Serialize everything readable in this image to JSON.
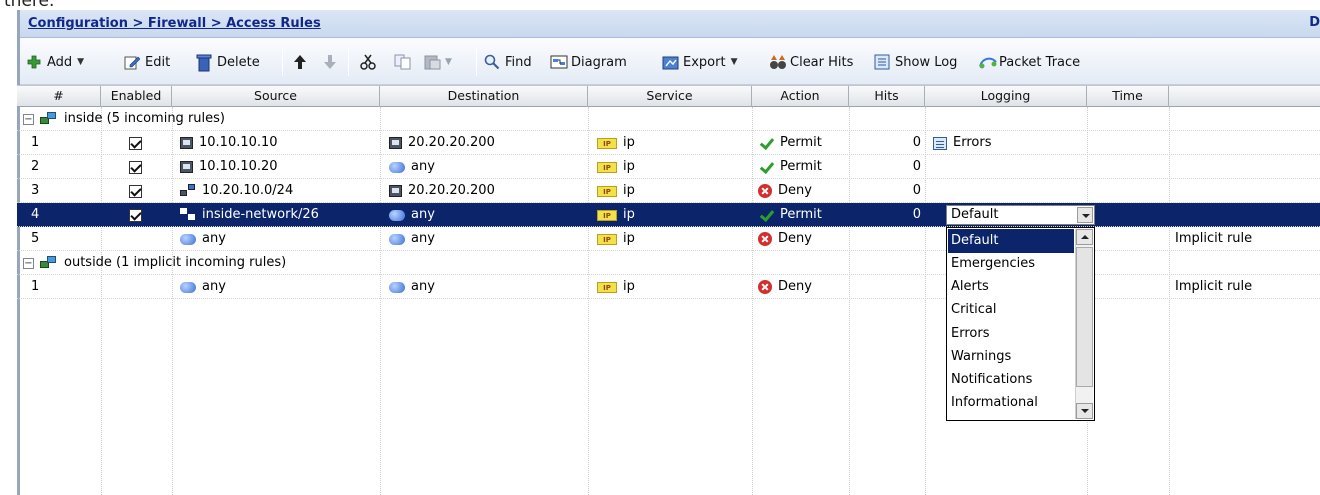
{
  "top_text": "there.",
  "breadcrumb": "Configuration > Firewall > Access Rules",
  "edge_letter": "D",
  "toolbar": {
    "add": "Add",
    "edit": "Edit",
    "delete": "Delete",
    "find": "Find",
    "diagram": "Diagram",
    "export": "Export",
    "clear_hits": "Clear Hits",
    "show_log": "Show Log",
    "packet_trace": "Packet Trace"
  },
  "columns": [
    "#",
    "Enabled",
    "Source",
    "Destination",
    "Service",
    "Action",
    "Hits",
    "Logging",
    "Time"
  ],
  "groups": [
    {
      "label": "inside (5 incoming rules)"
    },
    {
      "label": "outside (1 implicit incoming rules)"
    }
  ],
  "rows": [
    {
      "num": "1",
      "source": "10.10.10.10",
      "destination": "20.20.20.200",
      "service": "ip",
      "action": "Permit",
      "hits": "0",
      "logging": "Errors",
      "extra": ""
    },
    {
      "num": "2",
      "source": "10.10.10.20",
      "destination": "any",
      "service": "ip",
      "action": "Permit",
      "hits": "0",
      "logging": "",
      "extra": ""
    },
    {
      "num": "3",
      "source": "10.20.10.0/24",
      "destination": "20.20.20.200",
      "service": "ip",
      "action": "Deny",
      "hits": "0",
      "logging": "",
      "extra": ""
    },
    {
      "num": "4",
      "source": "inside-network/26",
      "destination": "any",
      "service": "ip",
      "action": "Permit",
      "hits": "0",
      "logging": "Default",
      "extra": ""
    },
    {
      "num": "5",
      "source": "any",
      "destination": "any",
      "service": "ip",
      "action": "Deny",
      "hits": "",
      "logging": "",
      "extra": "Implicit rule"
    },
    {
      "num": "1",
      "source": "any",
      "destination": "any",
      "service": "ip",
      "action": "Deny",
      "hits": "",
      "logging": "",
      "extra": "Implicit rule"
    }
  ],
  "ip_badge": "IP",
  "logging_options": [
    "Default",
    "Emergencies",
    "Alerts",
    "Critical",
    "Errors",
    "Warnings",
    "Notifications",
    "Informational"
  ],
  "colors": {
    "selection": "#0b246a",
    "breadcrumb": "#10288a",
    "permit": "#2aa02a",
    "deny": "#d32f2f"
  }
}
